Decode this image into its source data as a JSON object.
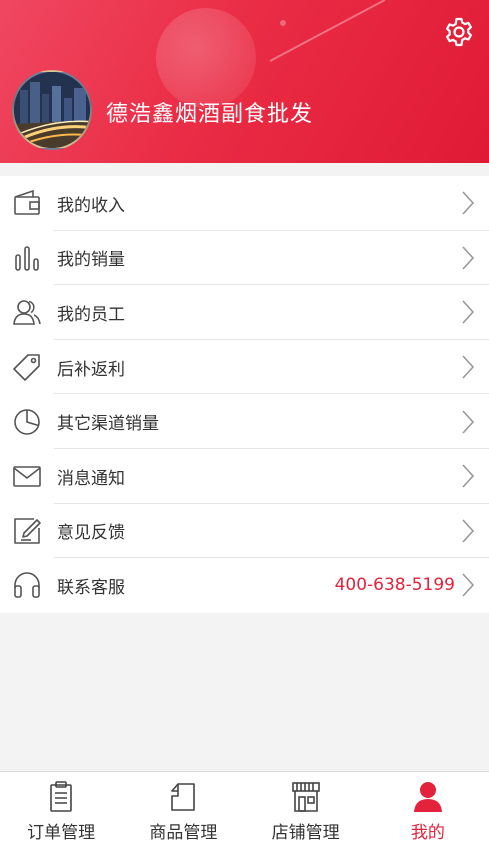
{
  "header": {
    "shop_name": "德浩鑫烟酒副食批发",
    "settings_icon": "gear-icon",
    "avatar": "city-night-avatar"
  },
  "menu": {
    "items": [
      {
        "label": "我的收入",
        "icon": "wallet-icon"
      },
      {
        "label": "我的销量",
        "icon": "bar-chart-icon"
      },
      {
        "label": "我的员工",
        "icon": "staff-icon"
      },
      {
        "label": "后补返利",
        "icon": "tag-icon"
      },
      {
        "label": "其它渠道销量",
        "icon": "pie-chart-icon"
      },
      {
        "label": "消息通知",
        "icon": "mail-icon"
      },
      {
        "label": "意见反馈",
        "icon": "edit-icon"
      },
      {
        "label": "联系客服",
        "icon": "headset-icon",
        "phone": "400-638-5199"
      }
    ]
  },
  "nav": {
    "items": [
      {
        "label": "订单管理",
        "icon": "clipboard-icon",
        "active": false
      },
      {
        "label": "商品管理",
        "icon": "product-icon",
        "active": false
      },
      {
        "label": "店铺管理",
        "icon": "store-icon",
        "active": false
      },
      {
        "label": "我的",
        "icon": "user-icon",
        "active": true
      }
    ]
  },
  "colors": {
    "accent": "#e2233b",
    "header_start": "#f04760",
    "header_end": "#e01a34",
    "text": "#333333",
    "background": "#f3f3f3"
  }
}
